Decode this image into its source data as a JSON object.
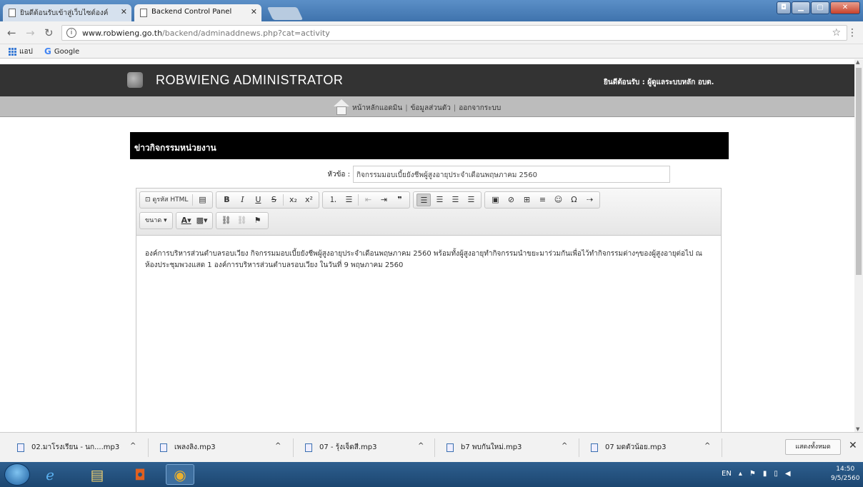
{
  "browser": {
    "tabs": [
      {
        "title": "ยินดีต้อนรับเข้าสู่เว็บไซต์องค์",
        "active": false
      },
      {
        "title": "Backend Control Panel",
        "active": true
      }
    ],
    "url_host": "www.robwieng.go.th",
    "url_path": "/backend/adminaddnews.php?cat=activity",
    "bookmarks": [
      "แอป",
      "Google"
    ]
  },
  "site": {
    "title": "ROBWIENG ADMINISTRATOR",
    "welcome": "ยินดีต้อนรับ :  ผู้ดูแลระบบหลัก อบต.",
    "nav": [
      "หน้าหลักแอดมิน",
      "ข้อมูลส่วนตัว",
      "ออกจากระบบ"
    ]
  },
  "form": {
    "heading": "ข่าวกิจกรรมหน่วยงาน",
    "subject_label": "หัวข้อ :",
    "subject_value": "กิจกรรมมอบเบี้ยยังชีพผู้สูงอายุประจำเดือนพฤษภาคม 2560",
    "editor": {
      "source_label": "ดูรหัส HTML",
      "size_label": "ขนาด",
      "body": "องค์การบริหารส่วนตำบลรอบเวียง  กิจกรรมมอบเบี้ยยังชีพผู้สูงอายุประจำเดือนพฤษภาคม 2560  พร้อมทั้งผู้สูงอายุทำกิจกรรมนำขยะมาร่วมกันเพื่อไว้ทำกิจกรรมต่างๆของผู้สูงอายุต่อไป  ณ ห้องประชุมพวงแสด 1 องค์การบริหารส่วนตำบลรอบเวียง  ในวันที่ 9 พฤษภาคม 2560"
    }
  },
  "downloads": {
    "items": [
      "02.มาโรงเรียน - นก....mp3",
      "เพลงลิง.mp3",
      "07 - รุ้งเจ็ดสี.mp3",
      "b7 พบกันใหม่.mp3",
      "07 มดตัวน้อย.mp3"
    ],
    "show_all": "แสดงทั้งหมด"
  },
  "taskbar": {
    "lang": "EN",
    "time": "14:50",
    "date": "9/5/2560"
  }
}
